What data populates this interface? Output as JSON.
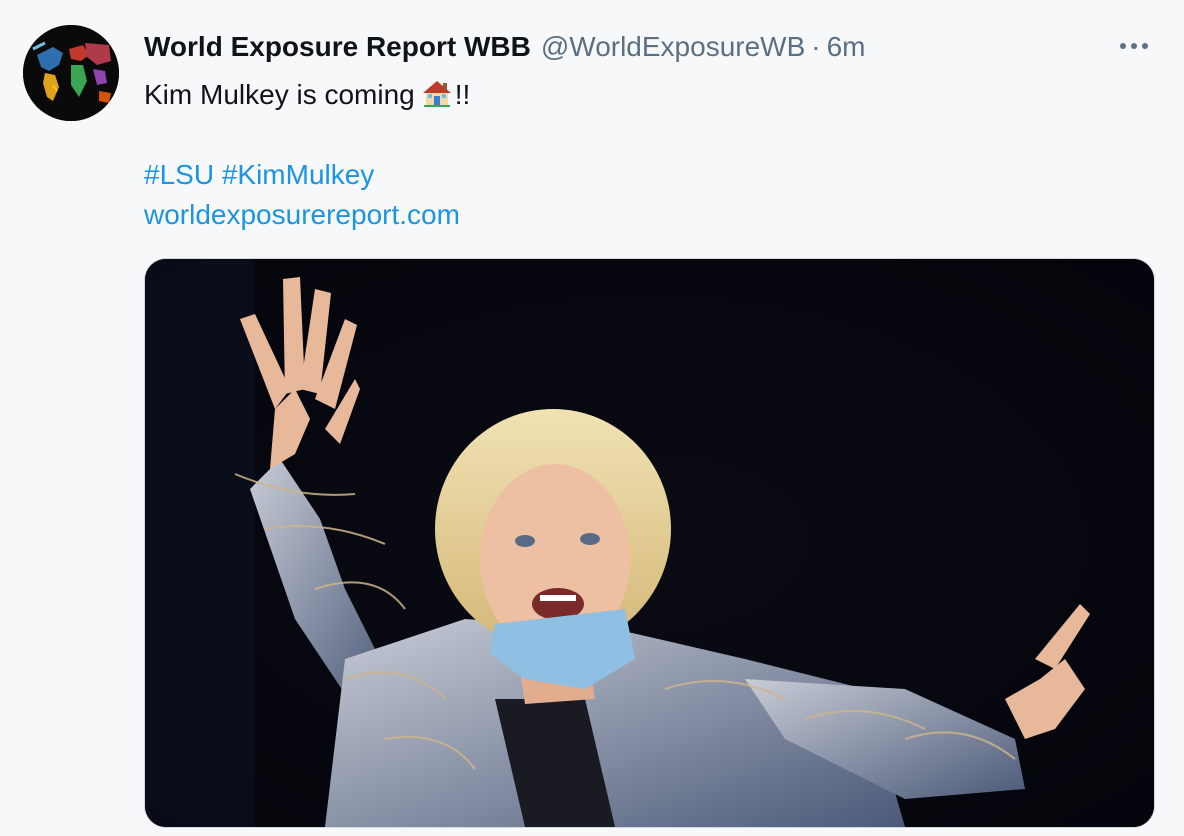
{
  "tweet": {
    "author": {
      "display_name": "World Exposure Report WBB",
      "handle": "@WorldExposureWB",
      "avatar_icon": "world-map-avatar"
    },
    "separator": "·",
    "timestamp": "6m",
    "more_icon": "more-options-icon",
    "text_line1": "Kim Mulkey is coming",
    "emoji": "house-emoji",
    "text_suffix": "!!",
    "hashtags": [
      "#LSU",
      "#KimMulkey"
    ],
    "link": "worldexposurereport.com",
    "media": {
      "type": "photo",
      "description_icon": "photo-coach-celebrating"
    },
    "colors": {
      "link": "#1b95e0",
      "secondary_text": "#5b7083",
      "primary_text": "#0f1419",
      "background": "#f7f8f9"
    }
  }
}
